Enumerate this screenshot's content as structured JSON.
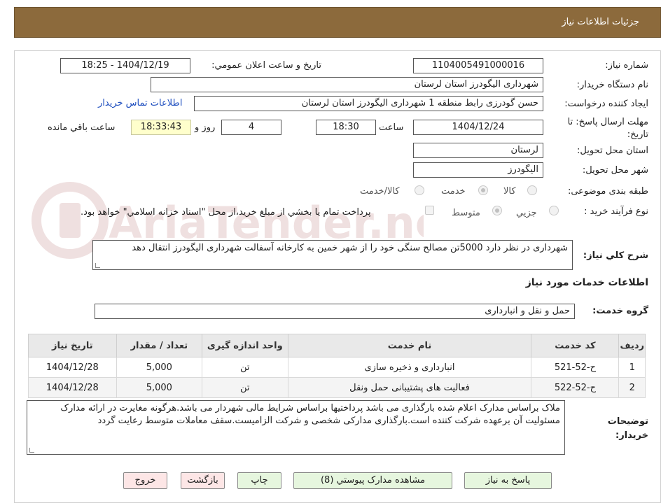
{
  "header": {
    "title": "جزئيات اطلاعات نياز"
  },
  "form": {
    "need_number_label": "شماره نياز:",
    "need_number": "1104005491000016",
    "announce_label": "تاريخ و ساعت اعلان عمومي:",
    "announce_value": "1404/12/19 - 18:25",
    "buyer_org_label": "نام دستگاه خريدار:",
    "buyer_org": "شهرداری الیگودرز استان لرستان",
    "requester_label": "ايجاد كننده درخواست:",
    "requester": "حسن گودرزی رابط منطقه 1 شهرداری الیگودرز استان لرستان",
    "contact_link": "اطلاعات تماس خريدار",
    "deadline_label": "مهلت ارسال پاسخ: تا تاريخ:",
    "deadline_date": "1404/12/24",
    "time_label": "ساعت",
    "deadline_time": "18:30",
    "days_value": "4",
    "days_label": "روز و",
    "remaining_time": "18:33:43",
    "remaining_label": "ساعت باقي مانده",
    "province_label": "استان محل تحويل:",
    "province": "لرستان",
    "city_label": "شهر محل تحويل:",
    "city": "الیگودرز",
    "category_label": "طبقه بندی موضوعی:",
    "category_options": [
      "كالا",
      "خدمت",
      "كالا/خدمت"
    ],
    "category_selected": "خدمت",
    "process_label": "نوع فرآيند خريد :",
    "process_options": [
      "جزيي",
      "متوسط"
    ],
    "process_selected": "متوسط",
    "payment_note": "پرداخت تمام يا بخشي از مبلغ خريد،از محل \"اسناد خزانه اسلامي\" خواهد بود."
  },
  "description": {
    "label": "شرح كلي نياز:",
    "text": "شهرداری در نظر دارد 5000تن مصالح سنگی خود را از شهر خمین به کارخانه آسفالت شهرداری الیگودرز انتقال دهد"
  },
  "services": {
    "section_title": "اطلاعات خدمات مورد نياز",
    "group_label": "گروه خدمت:",
    "group_value": "حمل و نقل و انبارداری",
    "columns": [
      "رديف",
      "كد خدمت",
      "نام خدمت",
      "واحد اندازه گيری",
      "تعداد / مقدار",
      "تاريخ نياز"
    ],
    "rows": [
      {
        "idx": "1",
        "code": "ح-52-521",
        "name": "انبارداری و ذخیره سازی",
        "unit": "تن",
        "qty": "5,000",
        "date": "1404/12/28"
      },
      {
        "idx": "2",
        "code": "ح-52-522",
        "name": "فعالیت های پشتیبانی حمل ونقل",
        "unit": "تن",
        "qty": "5,000",
        "date": "1404/12/28"
      }
    ]
  },
  "buyer_notes": {
    "label": "توضيحات خريدار:",
    "text": "ملاک براساس مدارک اعلام شده بارگذاری می باشد پرداختیها براساس شرایط مالی شهردار می باشد.هرگونه مغایرت در ارائه مدارک مسئولیت آن برعهده شرکت کننده است.بارگذاری مدارکی شخصی و شرکت الزامیست.سقف معاملات متوسط رعایت گردد"
  },
  "buttons": {
    "reply": "پاسخ به نياز",
    "view_docs": "مشاهده مدارک پيوستي (8)",
    "print": "چاپ",
    "back": "بازگشت",
    "exit": "خروج"
  },
  "watermark": {
    "text": "AriaTender.neT"
  },
  "colors": {
    "header_bg": "#8c6a3c",
    "green_button": "#e6f6de",
    "pink_button": "#fde6e6",
    "highlight": "#ffffcc"
  }
}
